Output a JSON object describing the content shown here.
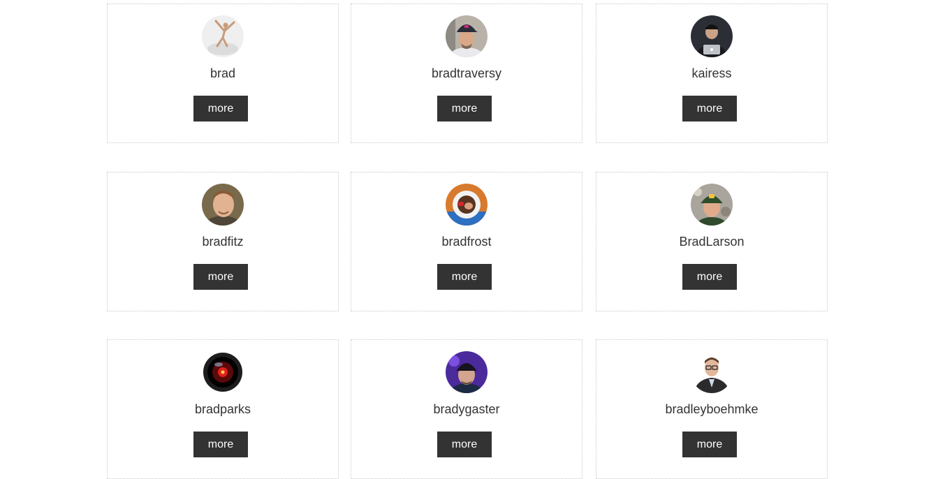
{
  "users": [
    {
      "login": "brad",
      "button": "more",
      "avatar_icon": "avatar-photo-dancer"
    },
    {
      "login": "bradtraversy",
      "button": "more",
      "avatar_icon": "avatar-photo-man-cap"
    },
    {
      "login": "kairess",
      "button": "more",
      "avatar_icon": "avatar-photo-man-laptop"
    },
    {
      "login": "bradfitz",
      "button": "more",
      "avatar_icon": "avatar-photo-man-smiling"
    },
    {
      "login": "bradfrost",
      "button": "more",
      "avatar_icon": "avatar-photo-astronaut-helmet"
    },
    {
      "login": "BradLarson",
      "button": "more",
      "avatar_icon": "avatar-photo-man-green-cap"
    },
    {
      "login": "bradparks",
      "button": "more",
      "avatar_icon": "avatar-hal-eye"
    },
    {
      "login": "bradygaster",
      "button": "more",
      "avatar_icon": "avatar-photo-man-purple"
    },
    {
      "login": "bradleyboehmke",
      "button": "more",
      "avatar_icon": "avatar-photo-man-glasses"
    }
  ],
  "colors": {
    "button_bg": "#333333",
    "button_text": "#ffffff",
    "username_text": "#333333",
    "card_border": "#c9c9c9"
  }
}
